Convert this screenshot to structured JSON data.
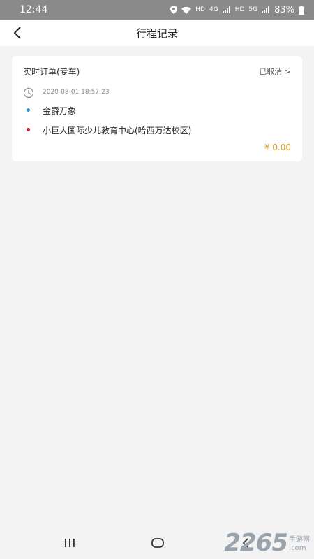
{
  "status_bar": {
    "time": "12:44",
    "hd1": "HD",
    "net1": "4G",
    "hd2": "HD",
    "net2": "5G",
    "battery": "83%"
  },
  "header": {
    "title": "行程记录"
  },
  "trip": {
    "type": "实时订单(专车)",
    "status": "已取消 >",
    "time": "2020-08-01 18:57:23",
    "origin": "金爵万象",
    "destination": "小巨人国际少儿教育中心(哈西万达校区)",
    "fare": "¥ 0.00",
    "colors": {
      "origin_dot": "#2c8fd4",
      "destination_dot": "#d32020",
      "fare": "#d99a1c"
    }
  },
  "watermark": {
    "number": "2265",
    "site": "手游网",
    "domain": ".com"
  },
  "icons": [
    "location-icon",
    "wifi-icon",
    "signal-icon",
    "battery-icon",
    "back-arrow-icon",
    "clock-icon",
    "recent-apps-icon",
    "home-icon",
    "nav-back-icon"
  ]
}
